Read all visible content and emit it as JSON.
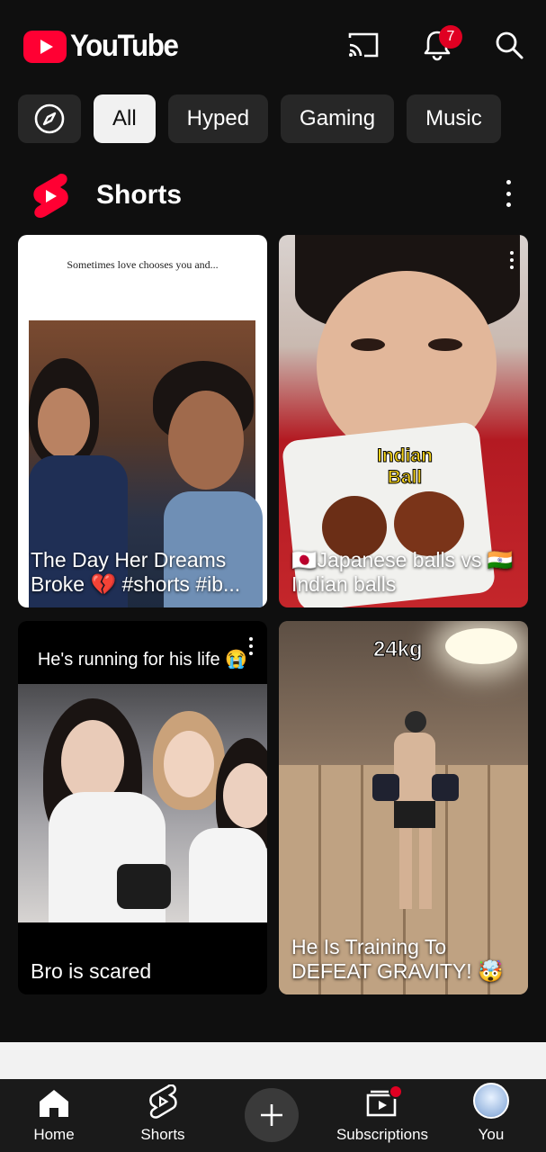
{
  "app": {
    "name": "YouTube"
  },
  "header": {
    "notification_count": "7"
  },
  "chips": [
    {
      "label": "All",
      "active": true
    },
    {
      "label": "Hyped",
      "active": false
    },
    {
      "label": "Gaming",
      "active": false
    },
    {
      "label": "Music",
      "active": false
    }
  ],
  "shorts": {
    "title": "Shorts",
    "items": [
      {
        "overlay_text": "Sometimes love chooses you and...",
        "caption": "The Day Her Dreams Broke 💔 #shorts #ib..."
      },
      {
        "overlay_text": "Indian Ball",
        "caption": "🇯🇵Japanese balls vs 🇮🇳Indian balls"
      },
      {
        "overlay_text": "He's running for his life 😭",
        "caption": "Bro is scared"
      },
      {
        "overlay_text": "24kg",
        "caption": "He Is Training To DEFEAT GRAVITY! 🤯"
      }
    ]
  },
  "nav": {
    "home": "Home",
    "shorts": "Shorts",
    "subscriptions": "Subscriptions",
    "you": "You"
  },
  "colors": {
    "brand": "#ff0033",
    "background": "#0f0f0f",
    "chip": "#272727",
    "chip_active": "#f1f1f1"
  }
}
